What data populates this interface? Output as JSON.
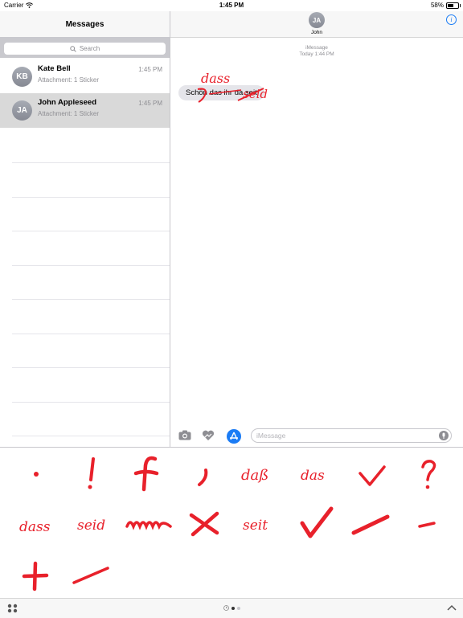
{
  "status_bar": {
    "carrier": "Carrier",
    "time": "1:45 PM",
    "battery": "58%"
  },
  "sidebar": {
    "title": "Messages",
    "search_placeholder": "Search",
    "conversations": [
      {
        "initials": "KB",
        "name": "Kate Bell",
        "preview": "Attachment: 1 Sticker",
        "time": "1:45 PM",
        "selected": false
      },
      {
        "initials": "JA",
        "name": "John Appleseed",
        "preview": "Attachment: 1 Sticker",
        "time": "1:45 PM",
        "selected": true
      }
    ]
  },
  "conversation": {
    "contact_initials": "JA",
    "contact_name": "John",
    "service_label": "iMessage",
    "timestamp": "Today 1:44 PM",
    "message_text": "Schön das ihr da seit",
    "sticker_words": [
      "dass",
      "seid"
    ]
  },
  "compose": {
    "placeholder": "iMessage"
  },
  "drawer": {
    "sticker_labels": [
      "daß",
      "das",
      "dass",
      "seid",
      "seit"
    ]
  },
  "colors": {
    "accent": "#1b7cf5",
    "sticker_red": "#e8212b",
    "bubble_gray": "#e5e5ea"
  }
}
